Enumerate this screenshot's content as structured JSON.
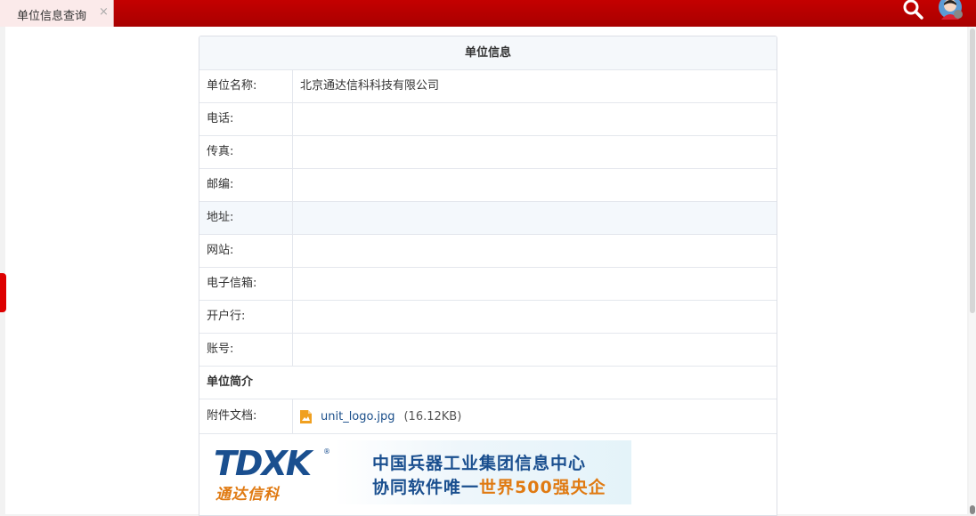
{
  "tabbar": {
    "active_tab": "单位信息查询",
    "close_glyph": "×"
  },
  "header_icons": {
    "search": "search-icon",
    "avatar": "avatar"
  },
  "colors": {
    "topbar": "#b80000",
    "accent_orange": "#e07a12",
    "brand_blue": "#1a4f8f",
    "link": "#1a4e8a"
  },
  "card": {
    "title": "单位信息",
    "rows": [
      {
        "label": "单位名称:",
        "value": "北京通达信科科技有限公司"
      },
      {
        "label": "电话:",
        "value": ""
      },
      {
        "label": "传真:",
        "value": ""
      },
      {
        "label": "邮编:",
        "value": ""
      },
      {
        "label": "地址:",
        "value": ""
      },
      {
        "label": "网站:",
        "value": ""
      },
      {
        "label": "电子信箱:",
        "value": ""
      },
      {
        "label": "开户行:",
        "value": ""
      },
      {
        "label": "账号:",
        "value": ""
      }
    ],
    "intro_label": "单位简介",
    "attachment": {
      "label": "附件文档:",
      "file_name": "unit_logo.jpg",
      "file_size": "(16.12KB)"
    }
  },
  "banner": {
    "logo_text": "TDXK",
    "logo_reg": "®",
    "logo_cn": "通达信科",
    "slogan_line1": "中国兵器工业集团信息中心",
    "slogan_line2_prefix": "协同软件唯一",
    "slogan_line2_accent": "世界500强央企"
  }
}
